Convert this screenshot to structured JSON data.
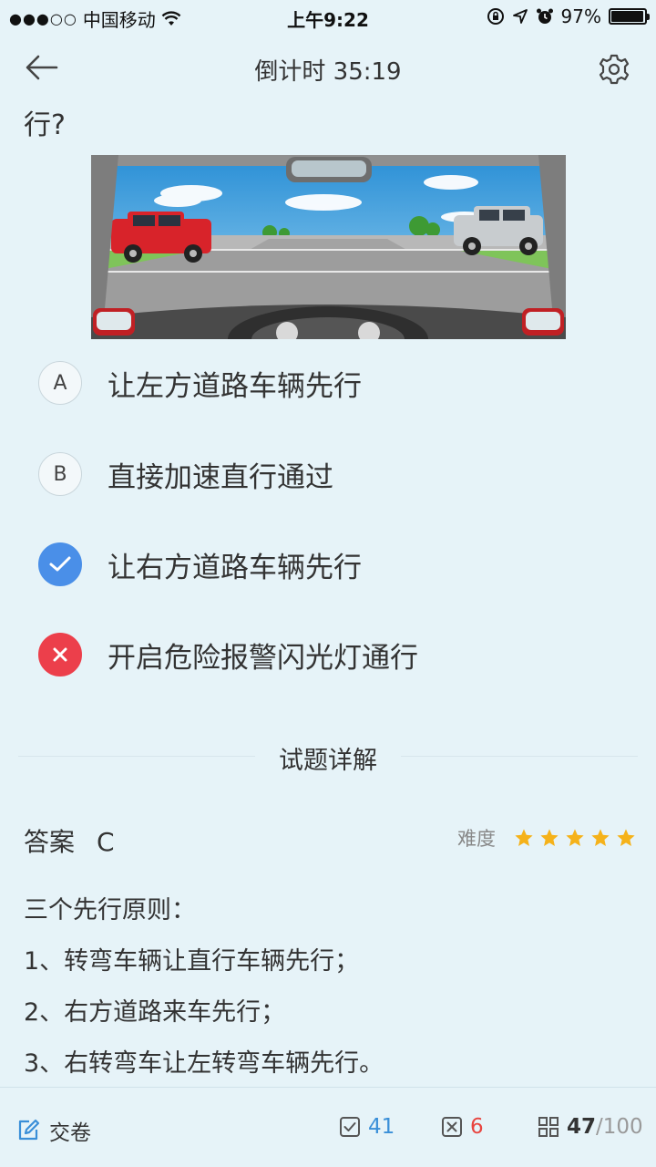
{
  "status_bar": {
    "carrier": "中国移动",
    "time": "上午9:22",
    "battery": "97%",
    "battery_level": 0.97
  },
  "nav": {
    "title": "倒计时 35:19"
  },
  "question": {
    "text_tail": "行?"
  },
  "options": [
    {
      "key": "A",
      "text": "让左方道路车辆先行",
      "state": "normal"
    },
    {
      "key": "B",
      "text": "直接加速直行通过",
      "state": "normal"
    },
    {
      "key": "C",
      "text": "让右方道路车辆先行",
      "state": "correct"
    },
    {
      "key": "D",
      "text": "开启危险报警闪光灯通行",
      "state": "wrong"
    }
  ],
  "detail": {
    "section_title": "试题详解",
    "answer_label": "答案",
    "answer_value": "C",
    "difficulty_label": "难度",
    "difficulty_stars": 5,
    "explanation": [
      "三个先行原则：",
      "1、转弯车辆让直行车辆先行；",
      "2、右方道路来车先行；",
      "3、右转弯车让左转弯车辆先行。"
    ]
  },
  "bottom_bar": {
    "submit_label": "交卷",
    "correct_count": "41",
    "wrong_count": "6",
    "progress_current": "47",
    "progress_total": "/100"
  },
  "colors": {
    "background": "#e6f3f8",
    "correct_blue": "#4a8fe8",
    "wrong_red": "#ec3f4b",
    "star_gold": "#f5b21a",
    "count_blue": "#3a8fd8",
    "count_red": "#e8443f"
  },
  "icons": {
    "back": "arrow-left-icon",
    "settings": "gear-icon",
    "submit": "edit-icon",
    "correct": "check-box-icon",
    "wrong": "x-box-icon",
    "progress": "grid-icon"
  }
}
